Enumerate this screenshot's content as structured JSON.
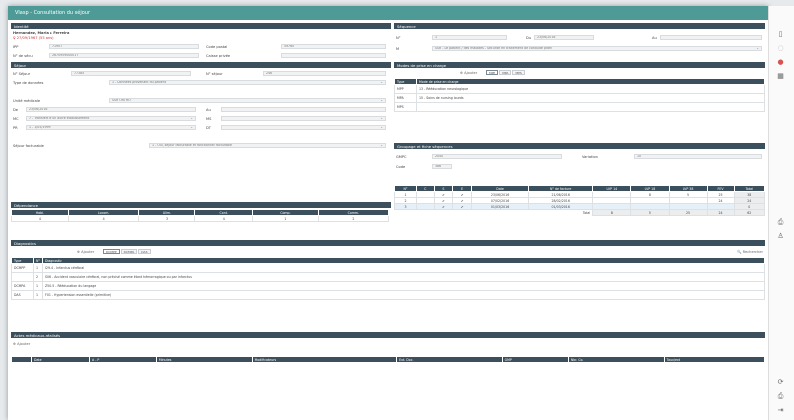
{
  "window": {
    "title": "Vlasp - Consultation du séjour"
  },
  "identite": {
    "title": "Identité",
    "name": "Hernandez, Maria ▸ Ferreira",
    "sub": "♀ 27/09/1967 (55 ans)",
    "ipp_label": "IPP",
    "ipp": "71907",
    "cp_label": "Code postal",
    "cp": "59760",
    "ns_label": "N° de sécu",
    "ns": "2670959000017",
    "caisse_label": "Caisse privée",
    "caisse": ""
  },
  "sejour": {
    "title": "Séjour",
    "ns_label": "N° Séjour",
    "ns": "77385",
    "nsej_label": "N° séjour",
    "nsej": "246",
    "type_label": "Type de données",
    "type": "1 - Données provenant du patient",
    "unite_label": "Unité médicale",
    "unite": "SSR ORTHO",
    "de_label": "De",
    "de": "23/06/2016",
    "a_label": "Au",
    "a": "",
    "mc_label": "MC",
    "mc": "7 - Transfert d'un autre établissement",
    "ms_label": "MS",
    "ms": "",
    "pr_label": "PR",
    "pr": "1 - 1/05/1999",
    "dt_label": "DT",
    "dt": "",
    "mj_label": "Séjour facturable",
    "mj": "1 - Oui, séjour facturable et fonctionnel facturable"
  },
  "dependance": {
    "title": "Dépendance",
    "headers": [
      "Habi.",
      "Locom.",
      "Alim.",
      "Cont.",
      "Comp.",
      "Comm."
    ],
    "values": [
      "4",
      "4",
      "3",
      "4",
      "1",
      "2"
    ]
  },
  "sequence": {
    "title": "Séquence",
    "n_label": "N°",
    "n": "1",
    "du_label": "Du",
    "du": "23/06/2016",
    "au_label": "Au",
    "au": "",
    "m_label": "M",
    "m": "SSR - Le patient / des malades - Sécurité en traitement de conduite profil"
  },
  "modes": {
    "title": "Modes de prise en charge",
    "add_label": "⊕ Ajouter",
    "tabs": [
      "MPP",
      "MPA",
      "MPS"
    ],
    "col_type": "Type",
    "col_mode": "Mode de prise en charge",
    "rows": [
      {
        "type": "MPP",
        "mode": "13 - Rééducation neurologique"
      },
      {
        "type": "MPA",
        "mode": "15 - Soins de nursing lourds"
      },
      {
        "type": "MPS",
        "mode": ""
      }
    ]
  },
  "groupage": {
    "title": "Groupage et fiche séquences",
    "gmpc_label": "GMPC",
    "gmpc": "2040",
    "variation_label": "Variation",
    "variation": "10",
    "code_label": "Code",
    "code": "386"
  },
  "actes": {
    "headers": [
      "N°",
      "C",
      "S",
      "E",
      "Date",
      "N° de facture",
      "LVP 14",
      "LVP 18",
      "LVP 38",
      "FEV",
      "Total"
    ],
    "rows": [
      [
        "1",
        "",
        "✔",
        "✔",
        "23/06/2016",
        "21/06/2016",
        "",
        "8",
        "5",
        "25",
        "",
        "38"
      ],
      [
        "2",
        "",
        "✔",
        "✔",
        "07/02/2016",
        "28/02/2016",
        "",
        "",
        "",
        "",
        "24",
        "24"
      ],
      [
        "3",
        "",
        "✔",
        "✔",
        "01/03/2016",
        "01/03/2016",
        "",
        "",
        "",
        "",
        "",
        "0"
      ]
    ],
    "total_label": "Total",
    "totals": [
      "8",
      "5",
      "25",
      "24",
      "62"
    ]
  },
  "diagnostics": {
    "title": "Diagnostics",
    "add_label": "⊕ Ajouter",
    "tabs": [
      "DCMPP",
      "DCMPA",
      "DAS"
    ],
    "search_label": "🔍 Rechercher",
    "col_type": "Type",
    "col_n": "N°",
    "col_diag": "Diagnostic",
    "rows": [
      {
        "type": "DCMPP",
        "n": "1",
        "diag": "I29.4 - Infarctus cérébral"
      },
      {
        "type": "",
        "n": "2",
        "diag": "S06 - Accident vasculaire cérébral, non précisé comme étant hémorragique ou par infarctus"
      },
      {
        "type": "DCMPA",
        "n": "1",
        "diag": "Z50.5 - Rééducation du langage"
      },
      {
        "type": "DAS",
        "n": "1",
        "diag": "F01 - Hypertension essentielle (primitive)"
      }
    ]
  },
  "csarr": {
    "title": "Actes médicaux-réalisés",
    "add_label": "⊕ Ajouter",
    "headers": [
      "",
      "Date",
      "A - P",
      "Minutes",
      "Modificateurs",
      "Ext. Doc.",
      "GMP",
      "Nbr. Co.",
      "Taux/ext"
    ]
  },
  "side": {
    "icons": [
      "file-icon",
      "circle-icon",
      "chrome-icon",
      "calculator-icon",
      "printer-icon",
      "user-icon",
      "refresh-icon",
      "print-icon",
      "exit-icon"
    ]
  }
}
